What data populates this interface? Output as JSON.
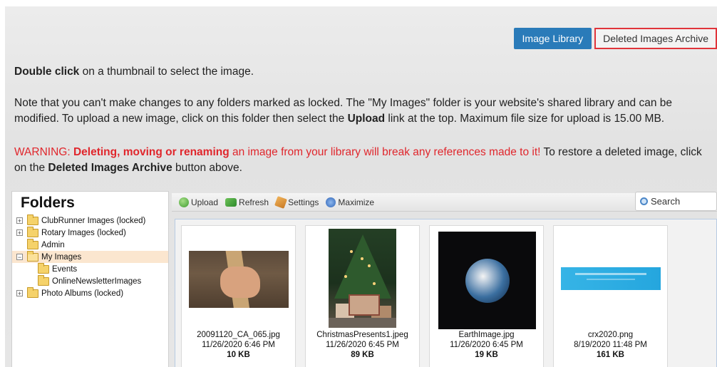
{
  "top_buttons": {
    "image_library": "Image Library",
    "deleted_archive": "Deleted Images Archive"
  },
  "instructions": {
    "line1_bold": "Double click",
    "line1_rest": " on a thumbnail to select the image.",
    "note_part1": "Note that you can't make changes to any folders marked as locked. The \"My Images\" folder is your website's shared library and can be modified. To upload a new image, click on this folder then select the ",
    "note_bold": "Upload",
    "note_part2": " link at the top. Maximum file size for upload is 15.00 MB.",
    "warning_prefix": "WARNING: ",
    "warning_bold": "Deleting, moving or renaming",
    "warning_mid": " an image from your library will break any references made to it!",
    "warning_rest": " To restore a deleted image, click on the ",
    "warning_bold2": "Deleted Images Archive",
    "warning_end": " button above."
  },
  "folders": {
    "title": "Folders",
    "items": [
      {
        "label": "ClubRunner Images (locked)",
        "expander": "+"
      },
      {
        "label": "Rotary Images (locked)",
        "expander": "+"
      },
      {
        "label": "Admin",
        "expander": ""
      },
      {
        "label": "My Images",
        "expander": "−"
      },
      {
        "label": "Events",
        "expander": ""
      },
      {
        "label": "OnlineNewsletterImages",
        "expander": ""
      },
      {
        "label": "Photo Albums (locked)",
        "expander": "+"
      }
    ]
  },
  "toolbar": {
    "upload": "Upload",
    "refresh": "Refresh",
    "settings": "Settings",
    "maximize": "Maximize",
    "search_placeholder": "Search"
  },
  "images": [
    {
      "name": "20091120_CA_065.jpg",
      "date": "11/26/2020 6:46 PM",
      "size": "10 KB"
    },
    {
      "name": "ChristmasPresents1.jpeg",
      "date": "11/26/2020 6:45 PM",
      "size": "89 KB"
    },
    {
      "name": "EarthImage.jpg",
      "date": "11/26/2020 6:45 PM",
      "size": "19 KB"
    },
    {
      "name": "crx2020.png",
      "date": "8/19/2020 11:48 PM",
      "size": "161 KB"
    }
  ],
  "colors": {
    "primary": "#2a7bb9",
    "warning": "#e0262c",
    "highlight_border": "#e0343a"
  }
}
